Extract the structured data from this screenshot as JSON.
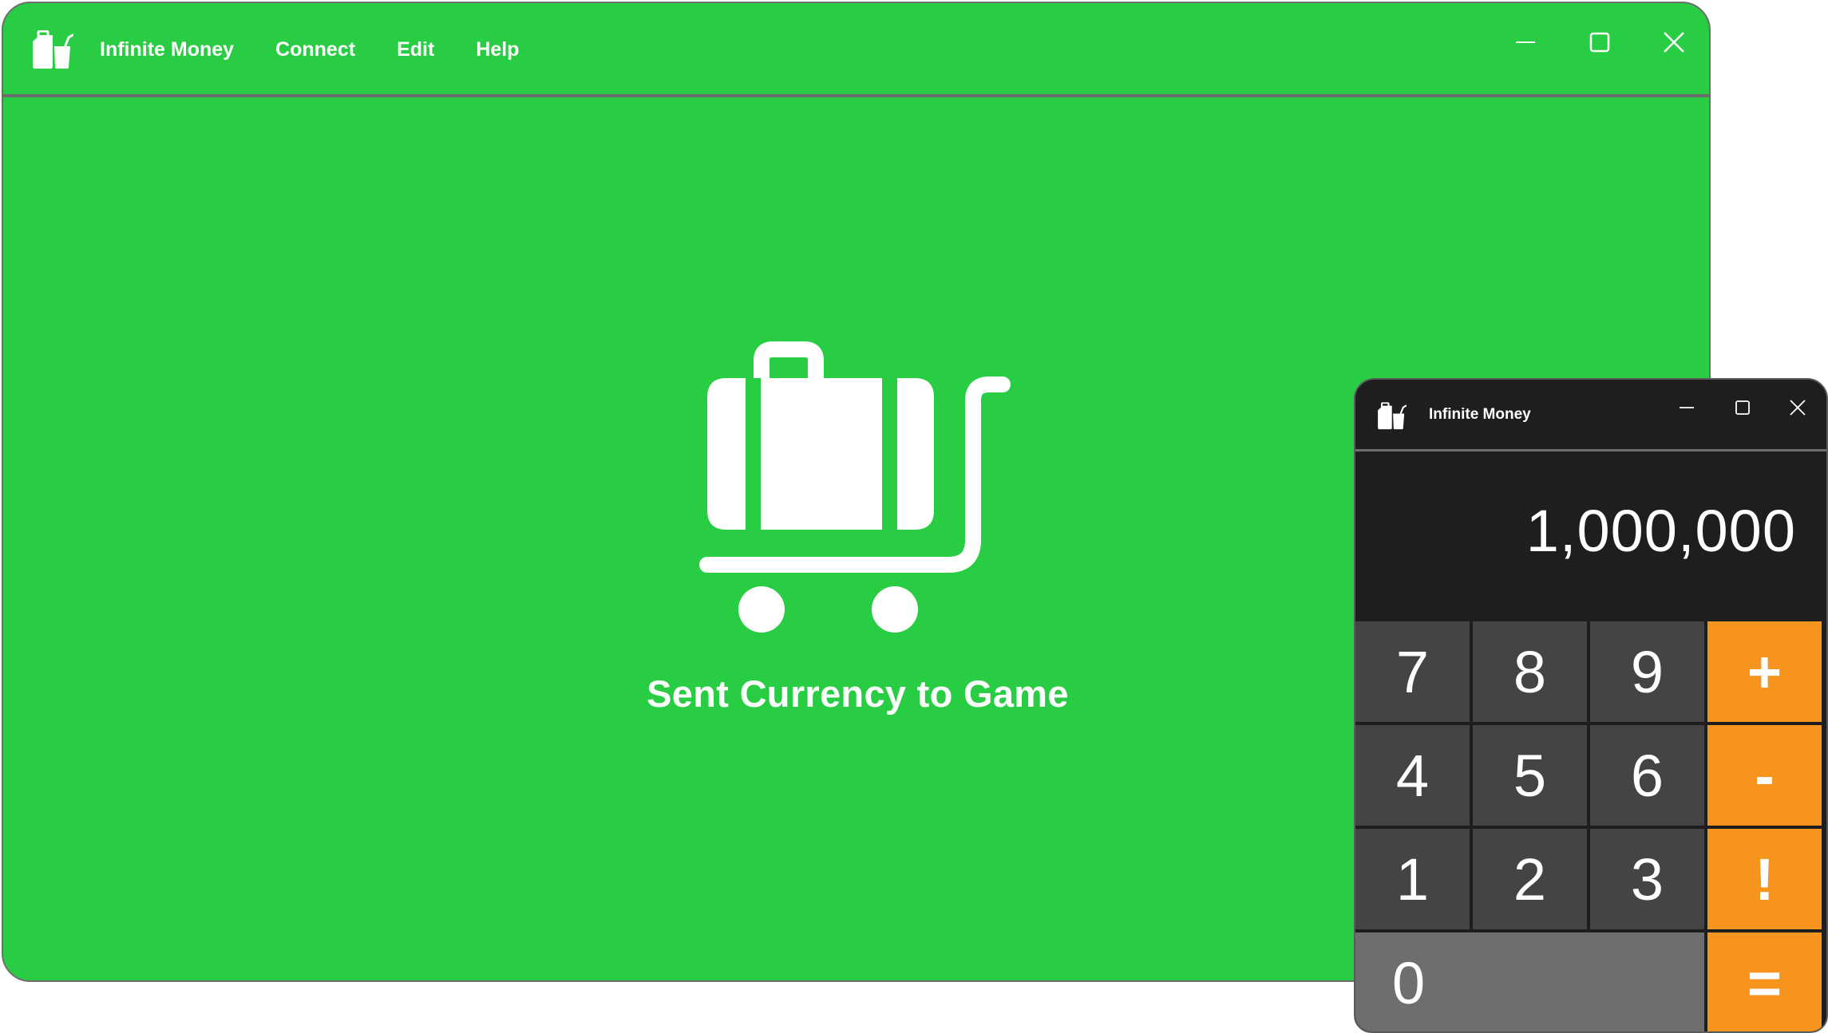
{
  "main_window": {
    "title": "Infinite Money",
    "menu": [
      "Connect",
      "Edit",
      "Help"
    ],
    "status": "Sent Currency to Game",
    "background_color": "#29cd44",
    "icons": {
      "app": "shopping-bags-icon",
      "center": "luggage-cart-icon",
      "minimize": "minimize-icon",
      "maximize": "maximize-icon",
      "close": "close-icon"
    }
  },
  "calculator": {
    "title": "Infinite Money",
    "display_value": "1,000,000",
    "keys": {
      "row1": [
        "7",
        "8",
        "9",
        "+"
      ],
      "row2": [
        "4",
        "5",
        "6",
        "-"
      ],
      "row3": [
        "1",
        "2",
        "3",
        "!"
      ],
      "row4": [
        "0",
        "="
      ]
    },
    "colors": {
      "number_key": "#444444",
      "operator_key": "#f7941e",
      "zero_key": "#6e6e6e",
      "display_bg": "#1e1e1e"
    }
  }
}
